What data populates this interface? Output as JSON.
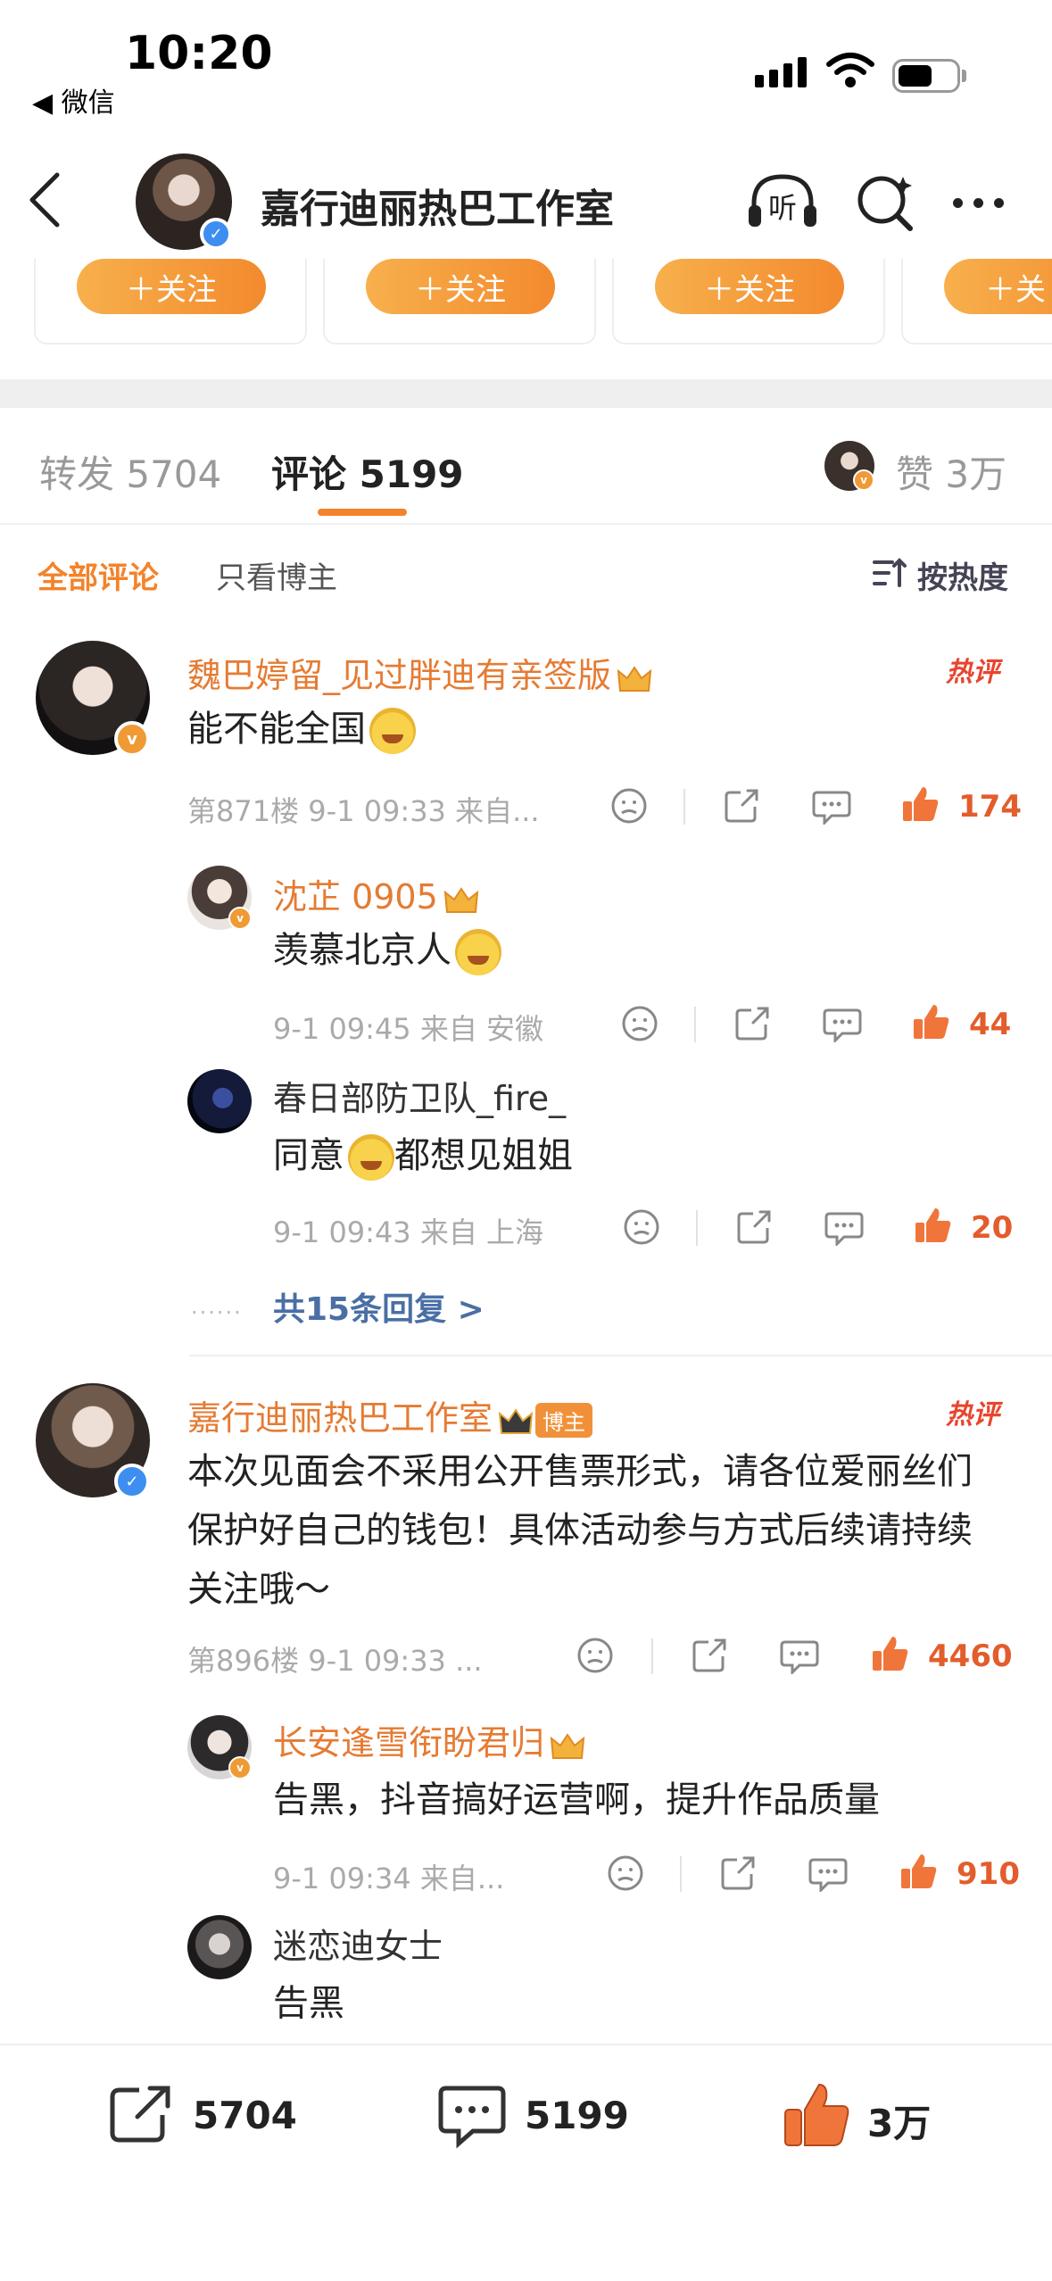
{
  "status_bar": {
    "time": "10:20",
    "back_app": "◀ 微信"
  },
  "nav": {
    "title": "嘉行迪丽热巴工作室",
    "listen_label": "听"
  },
  "recommend": {
    "follow_label": "＋关注",
    "follow_label_partial": "＋关"
  },
  "tabs": {
    "repost": "转发 5704",
    "comment": "评论 5199",
    "like": "赞 3万"
  },
  "filters": {
    "all": "全部评论",
    "host_only": "只看博主",
    "sort": "按热度"
  },
  "comments": [
    {
      "user": "魏巴婷留_见过胖迪有亲签版",
      "text": "能不能全国",
      "hot": "热评",
      "meta": "第871楼 9-1 09:33 来自...",
      "likes": "174",
      "replies": [
        {
          "user": "沈芷 0905",
          "text": "羡慕北京人",
          "meta": "9-1 09:45 来自 安徽",
          "likes": "44"
        },
        {
          "user": "春日部防卫队_fire_",
          "text_before": "同意",
          "text_after": "都想见姐姐",
          "meta": "9-1 09:43 来自 上海",
          "likes": "20"
        }
      ],
      "more_replies": "共15条回复 >",
      "dots": "......"
    },
    {
      "user": "嘉行迪丽热巴工作室",
      "host_badge": "博主",
      "hot": "热评",
      "text": "本次见面会不采用公开售票形式，请各位爱丽丝们保护好自己的钱包！具体活动参与方式后续请持续关注哦～",
      "meta": "第896楼 9-1 09:33 ...",
      "likes": "4460",
      "replies": [
        {
          "user": "长安逢雪衔盼君归",
          "text": "告黑，抖音搞好运营啊，提升作品质量",
          "meta": "9-1 09:34 来自...",
          "likes": "910"
        },
        {
          "user": "迷恋迪女士",
          "text": "告黑"
        }
      ]
    }
  ],
  "bottom_bar": {
    "repost": "5704",
    "comment": "5199",
    "like": "3万"
  },
  "colors": {
    "accent": "#f3832b",
    "hot": "#e8452e",
    "link": "#4a6fa5"
  }
}
